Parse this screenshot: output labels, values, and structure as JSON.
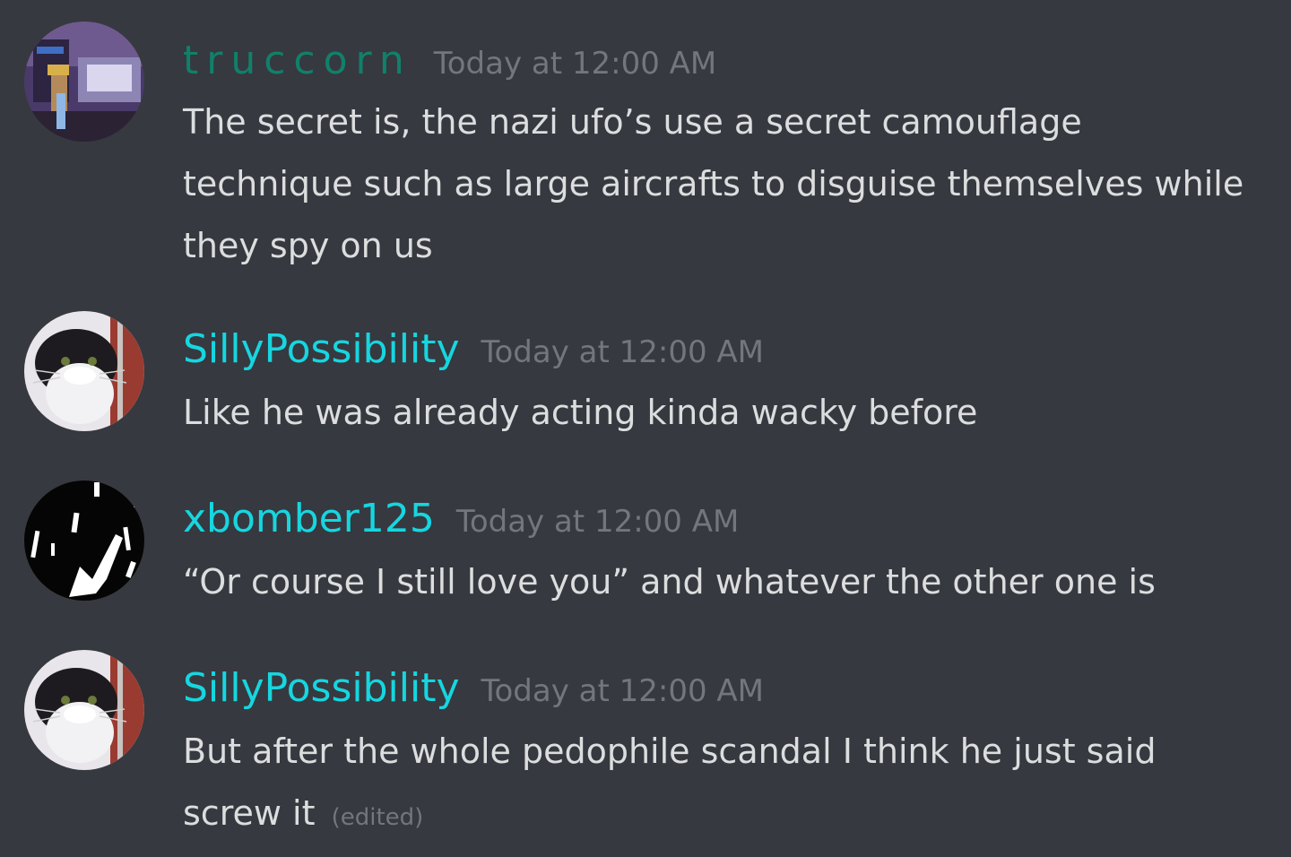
{
  "messages": [
    {
      "username": "truccorn",
      "timestamp": "Today at 12:00 AM",
      "text": "The secret is, the nazi ufo’s use a secret camouflage technique such as large aircrafts to disguise themselves while they spy on us",
      "edited": ""
    },
    {
      "username": "SillyPossibility",
      "timestamp": "Today at 12:00 AM",
      "text": "Like he was already acting kinda wacky before",
      "edited": ""
    },
    {
      "username": "xbomber125",
      "timestamp": "Today at 12:00 AM",
      "text": "“Or course I still love you” and whatever the other one is",
      "edited": ""
    },
    {
      "username": "SillyPossibility",
      "timestamp": "Today at 12:00 AM",
      "text": "But after the whole pedophile scandal I think he just said screw it",
      "edited": "(edited)"
    }
  ],
  "colors": {
    "background": "#36393f",
    "message_text": "#dcddde",
    "timestamp": "#72767d",
    "username_teal": "#11806a",
    "username_cyan": "#16d6e0"
  },
  "icons": {
    "avatar_truccorn": "photo-avatar-street-scene",
    "avatar_sillypossibility": "photo-avatar-cat",
    "avatar_xbomber125": "abstract-black-white-avatar"
  }
}
